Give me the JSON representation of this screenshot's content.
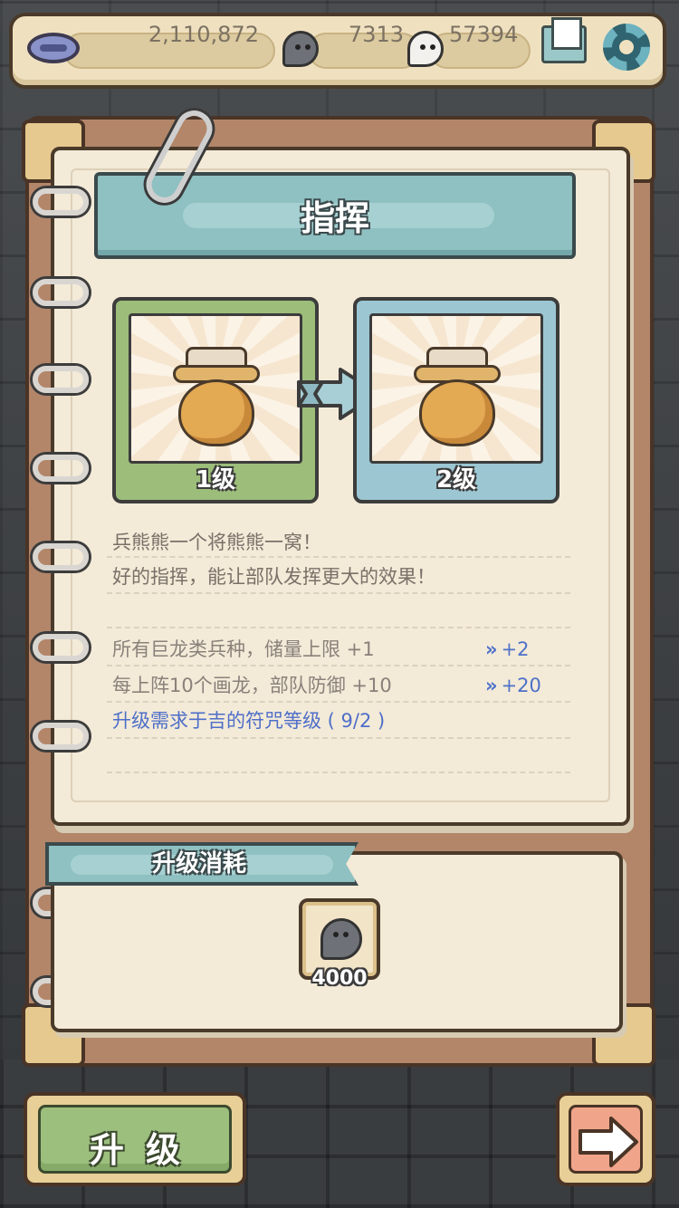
{
  "resources": {
    "coins": "2,110,872",
    "dark_soul": "7313",
    "light_soul": "57394"
  },
  "title": "指挥",
  "current_level": "1级",
  "next_level": "2级",
  "description": [
    "兵熊熊一个将熊熊一窝！",
    "好的指挥，能让部队发挥更大的效果！"
  ],
  "stats": [
    {
      "text": "所有巨龙类兵种，储量上限 +1",
      "bonus": "+2"
    },
    {
      "text": "每上阵10个画龙，部队防御 +10",
      "bonus": "+20"
    }
  ],
  "requirement": "升级需求于吉的符咒等级 ( 9/2 )",
  "cost": {
    "title": "升级消耗",
    "amount": "4000",
    "icon": "dark-soul-icon"
  },
  "buttons": {
    "upgrade": "升级",
    "next": "next-arrow-icon"
  },
  "colors": {
    "bonus": "#4e71c8",
    "requirement": "#4e6ec8",
    "current_card": "#9dbd7a",
    "next_card": "#9cc6d2"
  }
}
